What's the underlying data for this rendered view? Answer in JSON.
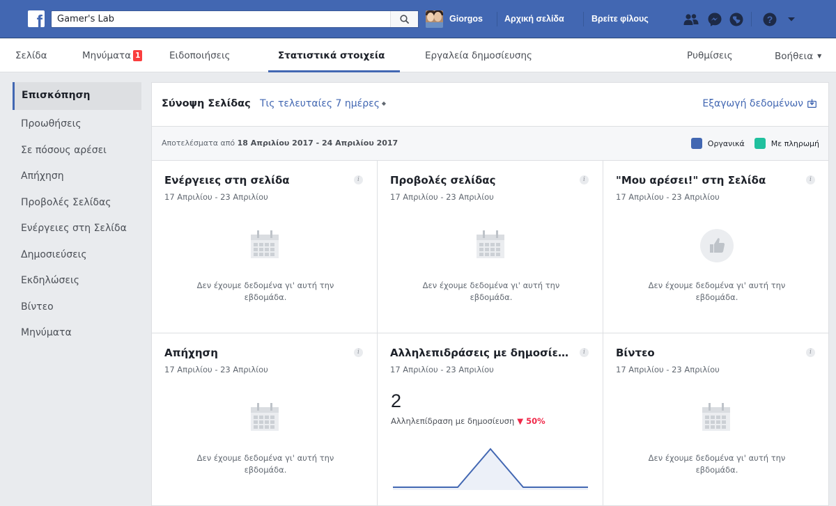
{
  "topbar": {
    "search_value": "Gamer's Lab",
    "user_name": "Giorgos",
    "home_label": "Αρχική σελίδα",
    "find_friends_label": "Βρείτε φίλους",
    "icons": [
      "facebook-logo-icon",
      "search-icon",
      "friend-requests-icon",
      "messenger-icon",
      "notifications-globe-icon",
      "help-icon",
      "account-menu-caret-icon"
    ],
    "brand_color": "#4267b2"
  },
  "pagenav": {
    "items": [
      {
        "label": "Σελίδα"
      },
      {
        "label": "Μηνύματα",
        "badge": "1"
      },
      {
        "label": "Ειδοποιήσεις"
      },
      {
        "label": "Στατιστικά στοιχεία",
        "active": true
      },
      {
        "label": "Εργαλεία δημοσίευσης"
      }
    ],
    "settings_label": "Ρυθμίσεις",
    "help_label": "Βοήθεια"
  },
  "sidebar": {
    "items": [
      {
        "label": "Επισκόπηση",
        "active": true
      },
      {
        "label": "Προωθήσεις"
      },
      {
        "label": "Σε πόσους αρέσει"
      },
      {
        "label": "Απήχηση"
      },
      {
        "label": "Προβολές Σελίδας"
      },
      {
        "label": "Ενέργειες στη Σελίδα"
      },
      {
        "label": "Δημοσιεύσεις"
      },
      {
        "label": "Εκδηλώσεις"
      },
      {
        "label": "Βίντεο"
      },
      {
        "label": "Μηνύματα"
      }
    ]
  },
  "main": {
    "title": "Σύνοψη Σελίδας",
    "range_label": "Τις τελευταίες 7 ημέρες",
    "export_label": "Εξαγωγή δεδομένων",
    "results_prefix": "Αποτελέσματα από",
    "results_range": "18 Απριλίου 2017 - 24 Απριλίου 2017",
    "legend": [
      {
        "label": "Οργανικά",
        "color": "#4267b2"
      },
      {
        "label": "Με πληρωμή",
        "color": "#20c09e"
      }
    ],
    "info_glyph": "i",
    "tiles": [
      {
        "title": "Ενέργειες στη σελίδα",
        "date": "17 Απριλίου - 23 Απριλίου",
        "empty": "Δεν έχουμε δεδομένα γι' αυτή την εβδομάδα.",
        "icon": "calendar-icon"
      },
      {
        "title": "Προβολές σελίδας",
        "date": "17 Απριλίου - 23 Απριλίου",
        "empty": "Δεν έχουμε δεδομένα γι' αυτή την εβδομάδα.",
        "icon": "calendar-icon"
      },
      {
        "title": "\"Μου αρέσει!\" στη Σελίδα",
        "date": "17 Απριλίου - 23 Απριλίου",
        "empty": "Δεν έχουμε δεδομένα γι' αυτή την εβδομάδα.",
        "icon": "thumbs-up-icon"
      },
      {
        "title": "Απήχηση",
        "date": "17 Απριλίου - 23 Απριλίου",
        "empty": "Δεν έχουμε δεδομένα γι' αυτή την εβδομάδα.",
        "icon": "calendar-icon"
      },
      {
        "title": "Αλληλεπιδράσεις με δημοσίε…",
        "date": "17 Απριλίου - 23 Απριλίου",
        "value": "2",
        "value_label": "Αλληλεπίδραση με δημοσίευση",
        "change": "▼ 50%"
      },
      {
        "title": "Βίντεο",
        "date": "17 Απριλίου - 23 Απριλίου",
        "empty": "Δεν έχουμε δεδομένα γι' αυτή την εβδομάδα.",
        "icon": "calendar-icon"
      }
    ]
  }
}
